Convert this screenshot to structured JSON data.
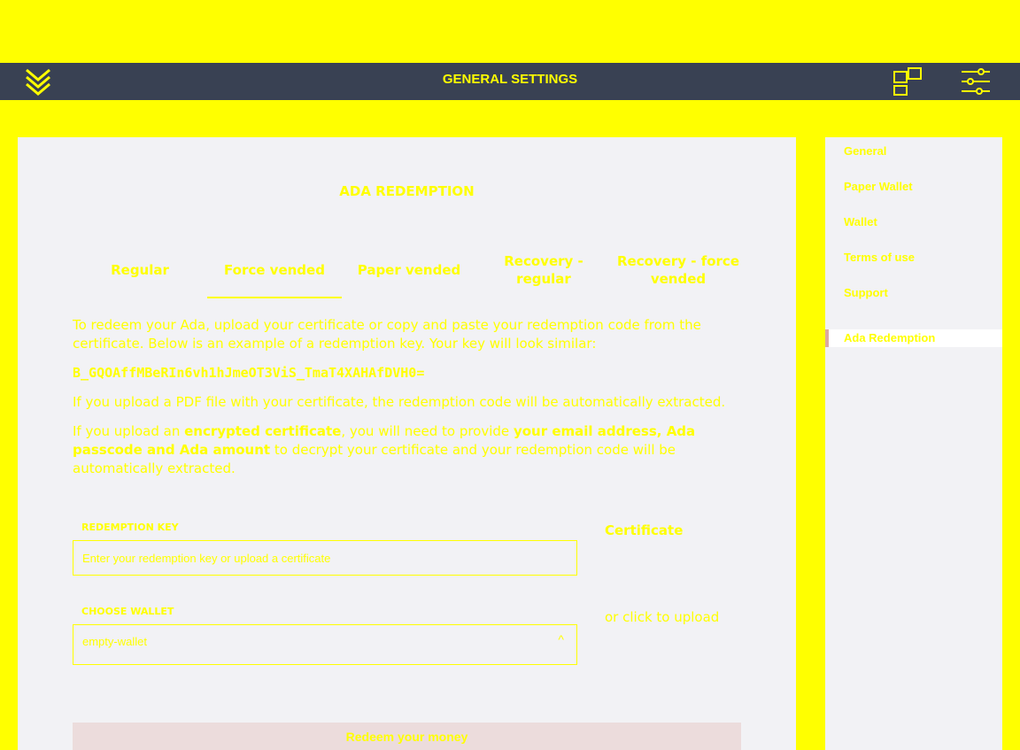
{
  "header": {
    "title": "GENERAL SETTINGS"
  },
  "main": {
    "heading": "ADA REDEMPTION",
    "tabs": [
      {
        "label": "Regular",
        "active": false
      },
      {
        "label": "Force vended",
        "active": true
      },
      {
        "label": "Paper vended",
        "active": false
      },
      {
        "label": "Recovery - regular",
        "active": false
      },
      {
        "label": "Recovery - force vended",
        "active": false
      }
    ],
    "intro": "To redeem your Ada, upload your certificate or copy and paste your redemption code from the certificate. Below is an example of a redemption key. Your key will look similar:",
    "example_key": "B_GQOAffMBeRIn6vh1hJmeOT3ViS_TmaT4XAHAfDVH0=",
    "pdf_note": "If you upload a PDF file with your certificate, the redemption code will be automatically extracted.",
    "encrypted_note": {
      "p1": "If you upload an ",
      "b1": "encrypted certificate",
      "p2": ", you will need to provide ",
      "b2": "your email address, Ada passcode and Ada amount",
      "p3": " to decrypt your certificate and your redemption code will be automatically extracted."
    },
    "redemption_key": {
      "label": "REDEMPTION KEY",
      "placeholder": "Enter your redemption key or upload a certificate",
      "value": ""
    },
    "wallet": {
      "label": "CHOOSE WALLET",
      "value": "empty-wallet"
    },
    "certificate": {
      "title": "Certificate",
      "hint": "or click to upload"
    },
    "submit_label": "Redeem your money"
  },
  "sidebar": {
    "items": [
      {
        "label": "General",
        "active": false
      },
      {
        "label": "Paper Wallet",
        "active": false
      },
      {
        "label": "Wallet",
        "active": false
      },
      {
        "label": "Terms of use",
        "active": false
      },
      {
        "label": "Support",
        "active": false
      },
      {
        "label": "Ada Redemption",
        "active": true
      }
    ]
  },
  "colors": {
    "header_bg": "#394153",
    "panel_bg": "#f2f2f5",
    "text": "#ffff00",
    "active_marker": "#dba8a0"
  }
}
